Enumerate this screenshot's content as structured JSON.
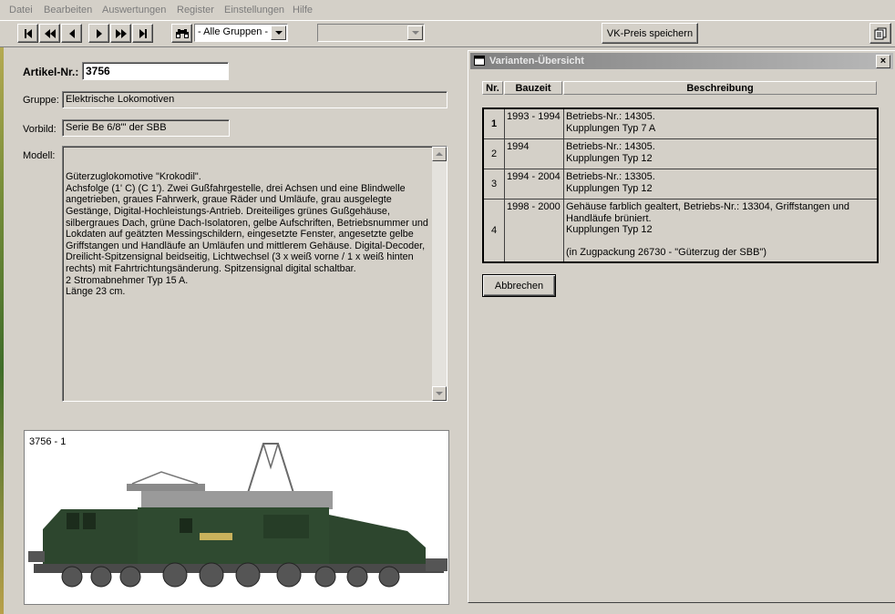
{
  "menu": [
    "Datei",
    "Bearbeiten",
    "Auswertungen",
    "Register",
    "Einstellungen",
    "Hilfe"
  ],
  "toolbar": {
    "group_filter": "- Alle Gruppen -",
    "save_price_label": "VK-Preis speichern"
  },
  "form": {
    "article_label": "Artikel-Nr.:",
    "article_value": "3756",
    "group_label": "Gruppe:",
    "group_value": "Elektrische Lokomotiven",
    "prototype_label": "Vorbild:",
    "prototype_value": "Serie Be 6/8\"' der SBB",
    "model_label": "Modell:",
    "model_text": "Güterzuglokomotive \"Krokodil\".\nAchsfolge (1' C) (C 1'). Zwei Gußfahrgestelle, drei Achsen und eine Blindwelle angetrieben, graues Fahrwerk, graue Räder und Umläufe, grau ausgelegte Gestänge, Digital-Hochleistungs-Antrieb. Dreiteiliges grünes Gußgehäuse, silbergraues Dach, grüne Dach-Isolatoren, gelbe Aufschriften, Betriebsnummer und Lokdaten auf geätzten Messingschildern, eingesetzte Fenster, angesetzte gelbe Griffstangen und Handläufe an Umläufen und mittlerem Gehäuse. Digital-Decoder, Dreilicht-Spitzensignal beidseitig, Lichtwechsel (3 x weiß vorne / 1 x weiß hinten rechts) mit Fahrtrichtungsänderung. Spitzensignal digital schaltbar.\n2 Stromabnehmer Typ 15 A.\nLänge 23 cm.",
    "image_caption": "3756 - 1"
  },
  "dialog": {
    "title": "Varianten-Übersicht",
    "close_glyph": "×",
    "columns": [
      "Nr.",
      "Bauzeit",
      "Beschreibung"
    ],
    "rows": [
      {
        "nr": "1",
        "bauzeit": "1993 - 1994",
        "beschreibung": "Betriebs-Nr.: 14305.\nKupplungen Typ 7 A"
      },
      {
        "nr": "2",
        "bauzeit": "1994",
        "beschreibung": "Betriebs-Nr.: 14305.\nKupplungen Typ 12"
      },
      {
        "nr": "3",
        "bauzeit": "1994 - 2004",
        "beschreibung": "Betriebs-Nr.: 13305.\nKupplungen Typ 12"
      },
      {
        "nr": "4",
        "bauzeit": "1998 - 2000",
        "beschreibung": "Gehäuse farblich gealtert, Betriebs-Nr.: 13304, Griffstangen und Handläufe brüniert.\nKupplungen Typ 12\n\n(in Zugpackung 26730 - \"Güterzug der SBB\")"
      }
    ],
    "cancel_label": "Abbrechen"
  },
  "colors": {
    "window_bg": "#d4d0c8",
    "titlebar_inactive": "#808080",
    "loco_green": "#2f4a30"
  }
}
